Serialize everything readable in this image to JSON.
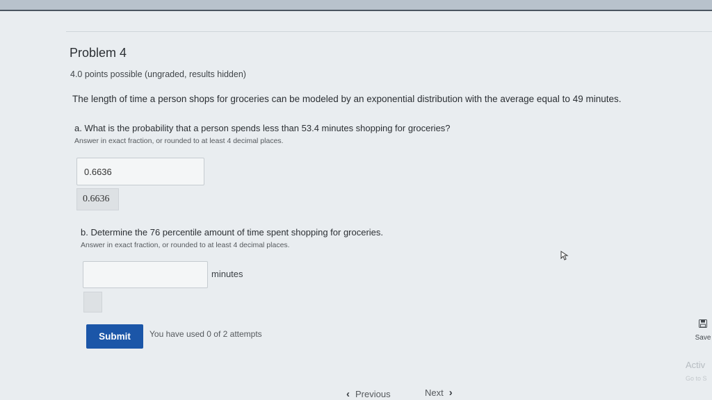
{
  "problem": {
    "title": "Problem 4",
    "points": "4.0 points possible (ungraded, results hidden)",
    "question": "The length of time a person shops for groceries can be modeled by an exponential distribution with the average equal to 49 minutes."
  },
  "part_a": {
    "label": "a. What is the probability that a person spends less than 53.4 minutes shopping for groceries?",
    "hint": "Answer in exact fraction, or rounded to at least 4 decimal places.",
    "input_value": "0.6636",
    "preview_value": "0.6636"
  },
  "part_b": {
    "label": "b. Determine the 76 percentile amount of time spent shopping for groceries.",
    "hint": "Answer in exact fraction, or rounded to at least 4 decimal places.",
    "input_value": "",
    "units": "minutes"
  },
  "actions": {
    "submit_label": "Submit",
    "attempts_text": "You have used 0 of 2 attempts",
    "save_label": "Save"
  },
  "navigation": {
    "previous_label": "Previous",
    "next_label": "Next"
  },
  "watermark": {
    "line1": "Activ",
    "line2": "Go to S"
  },
  "colors": {
    "submit_button": "#1b56a8",
    "background": "#e9edf0"
  },
  "icons": {
    "save": "save-icon",
    "previous": "chevron-left-icon",
    "next": "chevron-right-icon",
    "cursor": "mouse-pointer-icon"
  }
}
